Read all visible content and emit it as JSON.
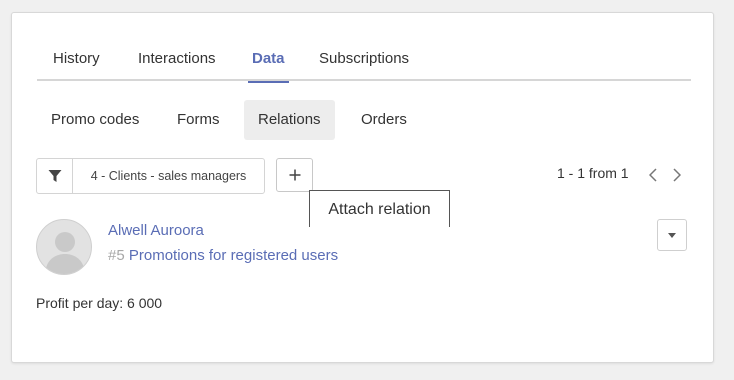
{
  "main_tabs": [
    {
      "label": "History",
      "active": false
    },
    {
      "label": "Interactions",
      "active": false
    },
    {
      "label": "Data",
      "active": true
    },
    {
      "label": "Subscriptions",
      "active": false
    }
  ],
  "sub_tabs": [
    {
      "label": "Promo codes",
      "active": false
    },
    {
      "label": "Forms",
      "active": false
    },
    {
      "label": "Relations",
      "active": true
    },
    {
      "label": "Orders",
      "active": false
    }
  ],
  "filter": {
    "icon": "filter-icon",
    "value": "4 - Clients - sales managers"
  },
  "add_button": {
    "icon": "plus-icon"
  },
  "tooltip": {
    "text": "Attach relation"
  },
  "pagination": {
    "text": "1 - 1 from 1",
    "prev_icon": "chevron-left-icon",
    "next_icon": "chevron-right-icon"
  },
  "record": {
    "avatar_icon": "user-avatar-icon",
    "name": "Alwell Auroora",
    "promo_number": "#5",
    "promo_name": "Promotions for registered users",
    "profit": "Profit per day: 6 000",
    "menu_icon": "caret-down-icon"
  },
  "colors": {
    "accent": "#5a6db5",
    "background": "#f0f0f0",
    "card": "#ffffff",
    "active_subtab": "#ededed"
  }
}
